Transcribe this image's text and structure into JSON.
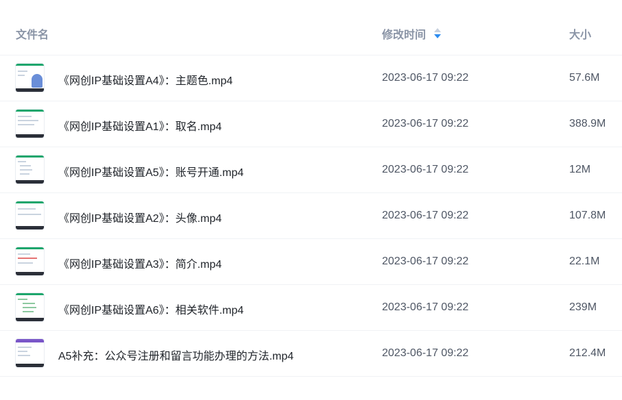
{
  "header": {
    "name_label": "文件名",
    "time_label": "修改时间",
    "size_label": "大小",
    "sort_icon": "sort-desc-icon",
    "accent_color": "#2d8cf0"
  },
  "files": [
    {
      "name": "《网创IP基础设置A4》：主题色.mp4",
      "time": "2023-06-17 09:22",
      "size": "57.6M"
    },
    {
      "name": "《网创IP基础设置A1》：取名.mp4",
      "time": "2023-06-17 09:22",
      "size": "388.9M"
    },
    {
      "name": "《网创IP基础设置A5》：账号开通.mp4",
      "time": "2023-06-17 09:22",
      "size": "12M"
    },
    {
      "name": "《网创IP基础设置A2》：头像.mp4",
      "time": "2023-06-17 09:22",
      "size": "107.8M"
    },
    {
      "name": "《网创IP基础设置A3》：简介.mp4",
      "time": "2023-06-17 09:22",
      "size": "22.1M"
    },
    {
      "name": "《网创IP基础设置A6》：相关软件.mp4",
      "time": "2023-06-17 09:22",
      "size": "239M"
    },
    {
      "name": "A5补充：公众号注册和留言功能办理的方法.mp4",
      "time": "2023-06-17 09:22",
      "size": "212.4M"
    }
  ]
}
